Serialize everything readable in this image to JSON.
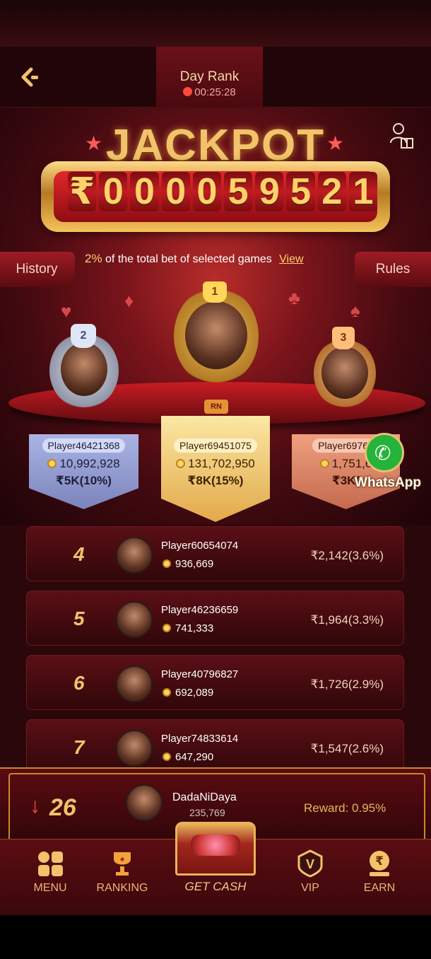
{
  "header": {
    "title": "Day Rank",
    "timer": "00:25:28"
  },
  "jackpot": {
    "word": "JACKPOT",
    "currency": "₹",
    "digits": [
      "0",
      "0",
      "0",
      "0",
      "5",
      "9",
      "5",
      "2",
      "1"
    ]
  },
  "buttons": {
    "history": "History",
    "rules": "Rules"
  },
  "description": {
    "percent": "2%",
    "text": " of the total bet of selected games ",
    "view": "View"
  },
  "top3": {
    "first": {
      "rank": "1",
      "name": "Player69451075",
      "coins": "131,702,950",
      "reward": "₹8K(15%)"
    },
    "second": {
      "rank": "2",
      "name": "Player46421368",
      "coins": "10,992,928",
      "reward": "₹5K(10%)"
    },
    "third": {
      "rank": "3",
      "name": "Player69764",
      "coins": "1,751,6",
      "reward": "₹3K("
    }
  },
  "whatsapp": {
    "label": "WhatsApp"
  },
  "rows": [
    {
      "rank": "4",
      "name": "Player60654074",
      "coins": "936,669",
      "reward": "₹2,142(3.6%)"
    },
    {
      "rank": "5",
      "name": "Player46236659",
      "coins": "741,333",
      "reward": "₹1,964(3.3%)"
    },
    {
      "rank": "6",
      "name": "Player40796827",
      "coins": "692,089",
      "reward": "₹1,726(2.9%)"
    },
    {
      "rank": "7",
      "name": "Player74833614",
      "coins": "647,290",
      "reward": "₹1,547(2.6%)"
    }
  ],
  "me": {
    "rank": "26",
    "name": "DadaNiDaya",
    "coins": "235,769",
    "reward": "Reward: 0.95%"
  },
  "nav": {
    "menu": "MENU",
    "ranking": "RANKING",
    "get_cash": "GET CASH",
    "vip": "VIP",
    "earn": "EARN"
  },
  "colors": {
    "accent_gold": "#f3c26a",
    "background": "#2a070b",
    "down_arrow": "#ff4b3a"
  }
}
